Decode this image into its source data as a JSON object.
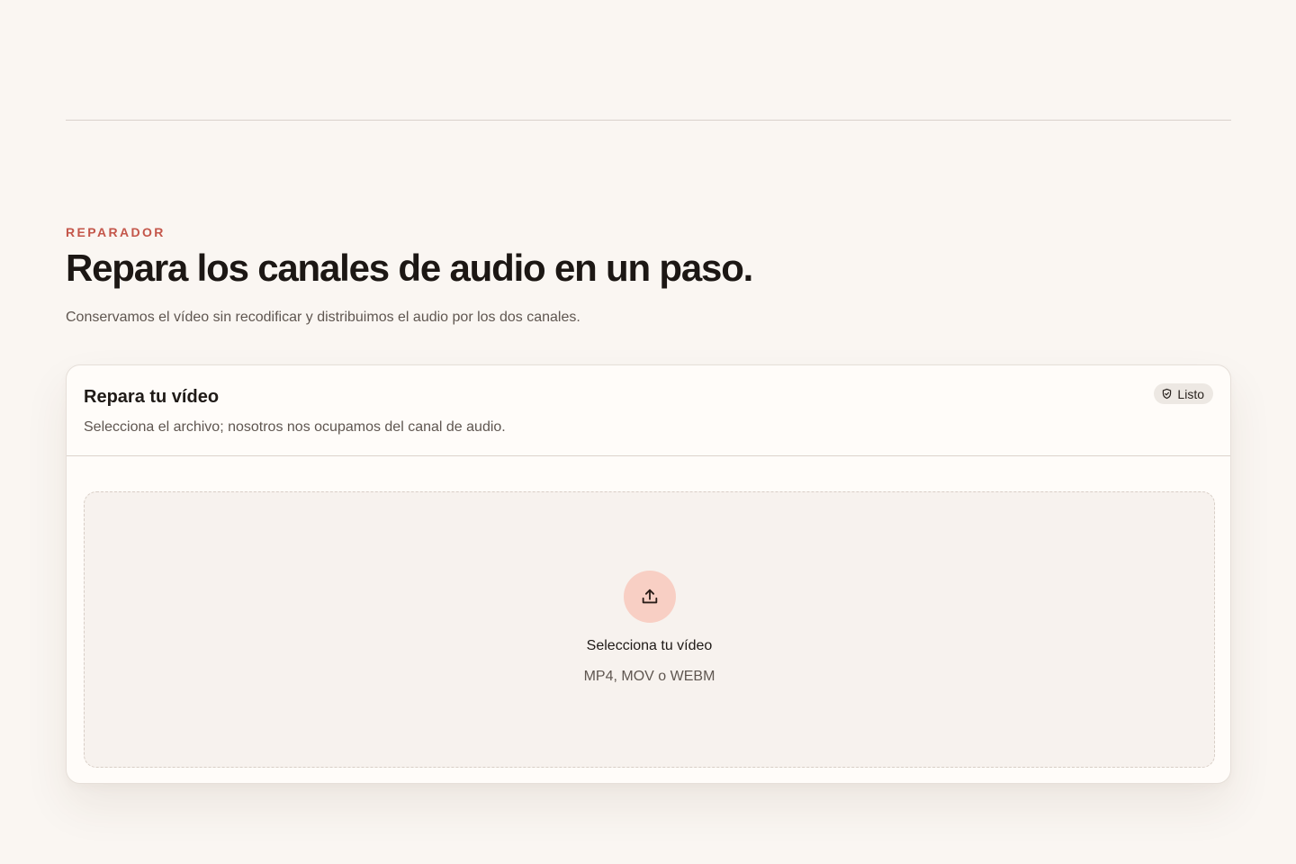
{
  "hero": {
    "eyebrow": "REPARADOR",
    "title": "Repara los canales de audio en un paso.",
    "subtitle": "Conservamos el vídeo sin recodificar y distribuimos el audio por los dos canales."
  },
  "card": {
    "title": "Repara tu vídeo",
    "description": "Selecciona el archivo; nosotros nos ocupamos del canal de audio.",
    "status_badge": {
      "label": "Listo",
      "icon": "shield-check-icon"
    },
    "dropzone": {
      "icon": "upload-icon",
      "title": "Selecciona tu vídeo",
      "formats": "MP4, MOV o WEBM"
    }
  },
  "colors": {
    "background": "#faf6f2",
    "accent": "#c4564a",
    "upload_circle": "#f8cfc4",
    "badge_bg": "#ede8e3"
  }
}
